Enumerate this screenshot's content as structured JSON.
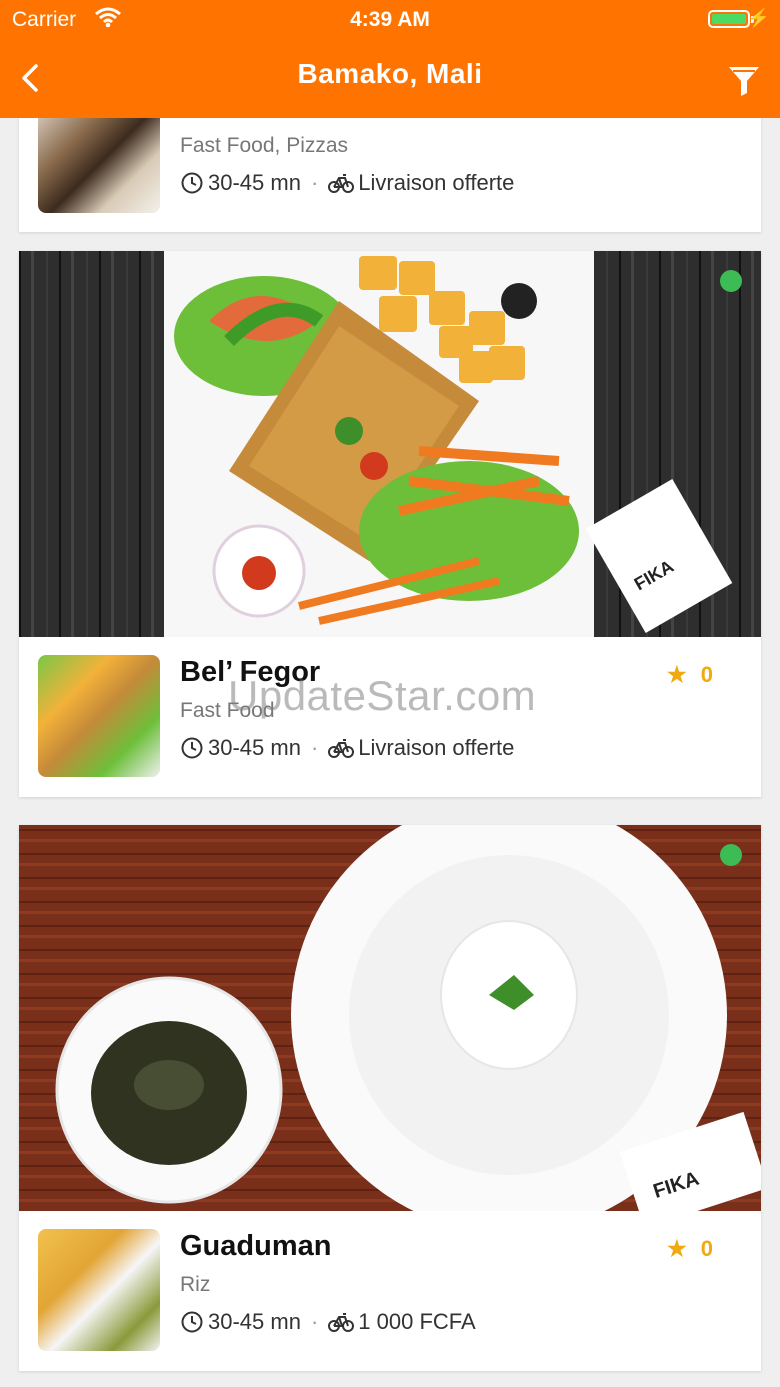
{
  "status": {
    "carrier": "Carrier",
    "time": "4:39 AM",
    "battery_level": 1.0
  },
  "header": {
    "title": "Bamako, Mali",
    "back_icon": "chevron-left-icon",
    "filter_icon": "funnel-icon",
    "bg_color": "#ff7300"
  },
  "restaurants": [
    {
      "category": "Fast Food, Pizzas",
      "delivery_time": "30-45 mn",
      "delivery_fee": "Livraison offerte"
    },
    {
      "name": "Bel’ Fegor",
      "category": "Fast Food",
      "delivery_time": "30-45 mn",
      "delivery_fee": "Livraison offerte",
      "rating": "0",
      "open": true
    },
    {
      "name": "Guaduman",
      "category": "Riz",
      "delivery_time": "30-45 mn",
      "delivery_fee": "1 000 FCFA",
      "rating": "0",
      "open": true
    }
  ],
  "watermark": "UpdateStar.com"
}
